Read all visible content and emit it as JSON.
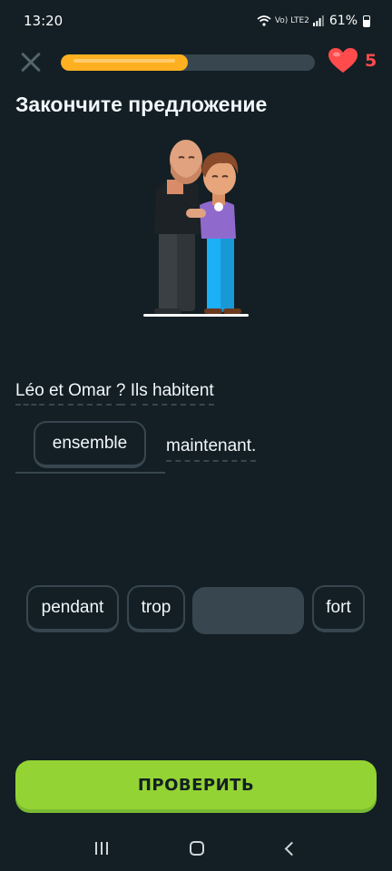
{
  "status_bar": {
    "time": "13:20",
    "battery": "61%",
    "signal_text": "Vo) LTE2"
  },
  "progress": {
    "fraction": 0.5
  },
  "hearts": {
    "count": "5",
    "icon": "heart-icon",
    "color": "#ff4b4b"
  },
  "title": "Закончите предложение",
  "sentence": {
    "line1_words": [
      "Léo",
      "et",
      "Omar",
      "?",
      "Ils",
      "habitent"
    ],
    "answer_word": "ensemble",
    "tail": "maintenant."
  },
  "word_bank": [
    "pendant",
    "trop",
    "fort"
  ],
  "check_button": "ПРОВЕРИТЬ",
  "colors": {
    "background": "#131f24",
    "accent_green": "#93d333",
    "progress_orange": "#ffb020",
    "heart_red": "#ff4b4b"
  }
}
